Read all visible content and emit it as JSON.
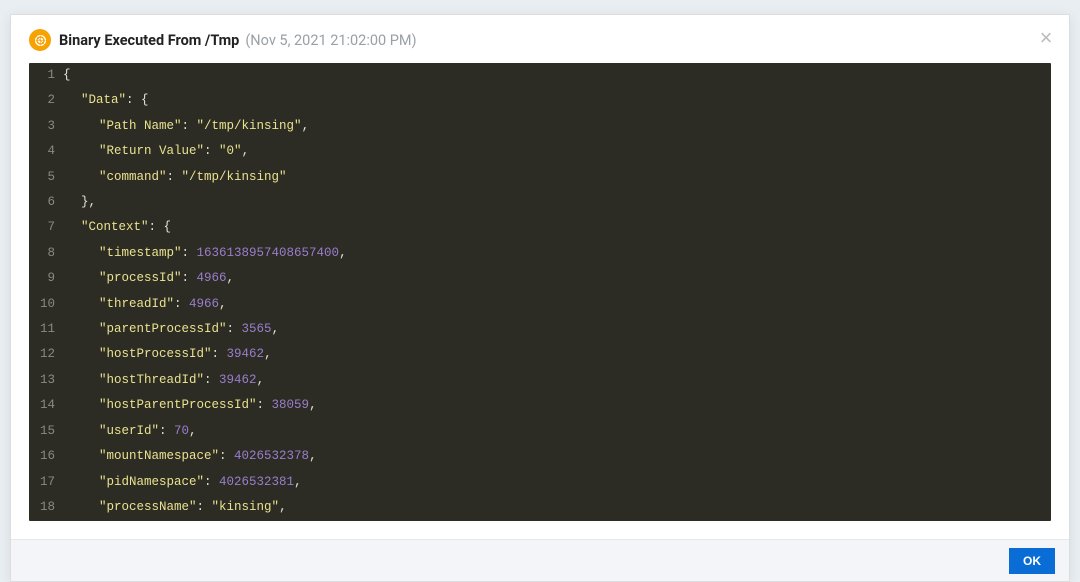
{
  "modal": {
    "title": "Binary Executed From /Tmp",
    "subtitle": "(Nov 5, 2021 21:02:00 PM)",
    "ok_label": "OK"
  },
  "code": {
    "lines": [
      {
        "n": "1",
        "html": "<span class='tok-punc'>{</span>"
      },
      {
        "n": "2",
        "html": "<span class='indent1'><span class='tok-key'>\"Data\"</span><span class='tok-punc'>: {</span></span>"
      },
      {
        "n": "3",
        "html": "<span class='indent2'><span class='tok-key'>\"Path Name\"</span><span class='tok-punc'>: </span><span class='tok-str'>\"/tmp/kinsing\"</span><span class='tok-punc'>,</span></span>"
      },
      {
        "n": "4",
        "html": "<span class='indent2'><span class='tok-key'>\"Return Value\"</span><span class='tok-punc'>: </span><span class='tok-str'>\"0\"</span><span class='tok-punc'>,</span></span>"
      },
      {
        "n": "5",
        "html": "<span class='indent2'><span class='tok-key'>\"command\"</span><span class='tok-punc'>: </span><span class='tok-str'>\"/tmp/kinsing\"</span></span>"
      },
      {
        "n": "6",
        "html": "<span class='indent1'><span class='tok-punc'>},</span></span>"
      },
      {
        "n": "7",
        "html": "<span class='indent1'><span class='tok-key'>\"Context\"</span><span class='tok-punc'>: {</span></span>"
      },
      {
        "n": "8",
        "html": "<span class='indent2'><span class='tok-key'>\"timestamp\"</span><span class='tok-punc'>: </span><span class='tok-num'>1636138957408657400</span><span class='tok-punc'>,</span></span>"
      },
      {
        "n": "9",
        "html": "<span class='indent2'><span class='tok-key'>\"processId\"</span><span class='tok-punc'>: </span><span class='tok-num'>4966</span><span class='tok-punc'>,</span></span>"
      },
      {
        "n": "10",
        "html": "<span class='indent2'><span class='tok-key'>\"threadId\"</span><span class='tok-punc'>: </span><span class='tok-num'>4966</span><span class='tok-punc'>,</span></span>"
      },
      {
        "n": "11",
        "html": "<span class='indent2'><span class='tok-key'>\"parentProcessId\"</span><span class='tok-punc'>: </span><span class='tok-num'>3565</span><span class='tok-punc'>,</span></span>"
      },
      {
        "n": "12",
        "html": "<span class='indent2'><span class='tok-key'>\"hostProcessId\"</span><span class='tok-punc'>: </span><span class='tok-num'>39462</span><span class='tok-punc'>,</span></span>"
      },
      {
        "n": "13",
        "html": "<span class='indent2'><span class='tok-key'>\"hostThreadId\"</span><span class='tok-punc'>: </span><span class='tok-num'>39462</span><span class='tok-punc'>,</span></span>"
      },
      {
        "n": "14",
        "html": "<span class='indent2'><span class='tok-key'>\"hostParentProcessId\"</span><span class='tok-punc'>: </span><span class='tok-num'>38059</span><span class='tok-punc'>,</span></span>"
      },
      {
        "n": "15",
        "html": "<span class='indent2'><span class='tok-key'>\"userId\"</span><span class='tok-punc'>: </span><span class='tok-num'>70</span><span class='tok-punc'>,</span></span>"
      },
      {
        "n": "16",
        "html": "<span class='indent2'><span class='tok-key'>\"mountNamespace\"</span><span class='tok-punc'>: </span><span class='tok-num'>4026532378</span><span class='tok-punc'>,</span></span>"
      },
      {
        "n": "17",
        "html": "<span class='indent2'><span class='tok-key'>\"pidNamespace\"</span><span class='tok-punc'>: </span><span class='tok-num'>4026532381</span><span class='tok-punc'>,</span></span>"
      },
      {
        "n": "18",
        "html": "<span class='indent2'><span class='tok-key'>\"processName\"</span><span class='tok-punc'>: </span><span class='tok-str'>\"kinsing\"</span><span class='tok-punc'>,</span></span>"
      }
    ]
  }
}
